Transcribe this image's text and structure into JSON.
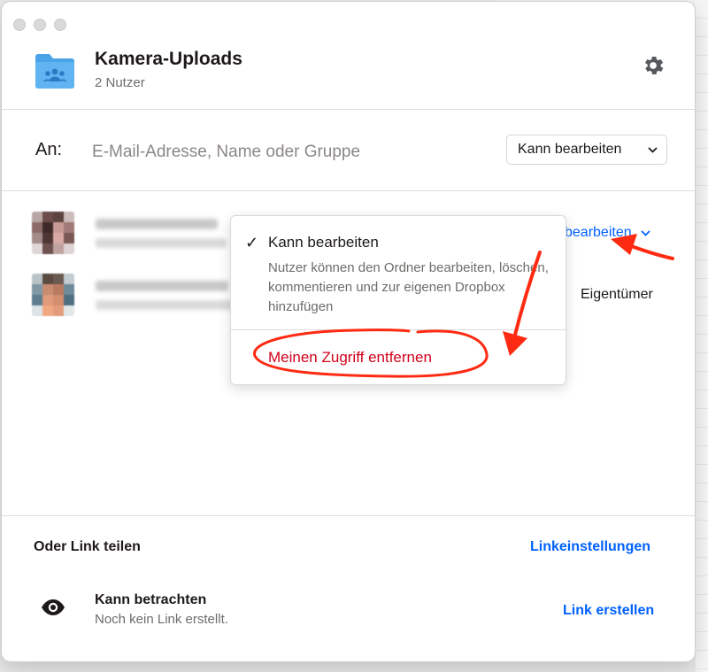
{
  "header": {
    "title": "Kamera-Uploads",
    "subtitle": "2 Nutzer",
    "folder_icon": "shared-folder-icon",
    "settings_icon": "gear-icon"
  },
  "invite": {
    "label": "An:",
    "placeholder": "E-Mail-Adresse, Name oder Gruppe",
    "value": "",
    "permission": "Kann bearbeiten"
  },
  "members": [
    {
      "avatar_blurred": true,
      "permission": "bearbeiten"
    },
    {
      "avatar_blurred": true,
      "permission": "Eigentümer"
    }
  ],
  "dropdown": {
    "check_glyph": "✓",
    "selected_option": "Kann bearbeiten",
    "selected_description": "Nutzer können den Ordner bearbeiten, löschen, kommentieren und zur eigenen Dropbox hinzufügen",
    "remove_label": "Meinen Zugriff entfernen"
  },
  "share_link": {
    "heading": "Oder Link teilen",
    "settings_label": "Linkeinstellungen",
    "view_icon": "eye-icon",
    "view_title": "Kann betrachten",
    "view_subtitle": "Noch kein Link erstellt.",
    "create_label": "Link erstellen"
  },
  "colors": {
    "accent": "#0061fe",
    "danger": "#d0021b",
    "annotation": "#ff2a12",
    "folder": "#4aa3e8"
  }
}
